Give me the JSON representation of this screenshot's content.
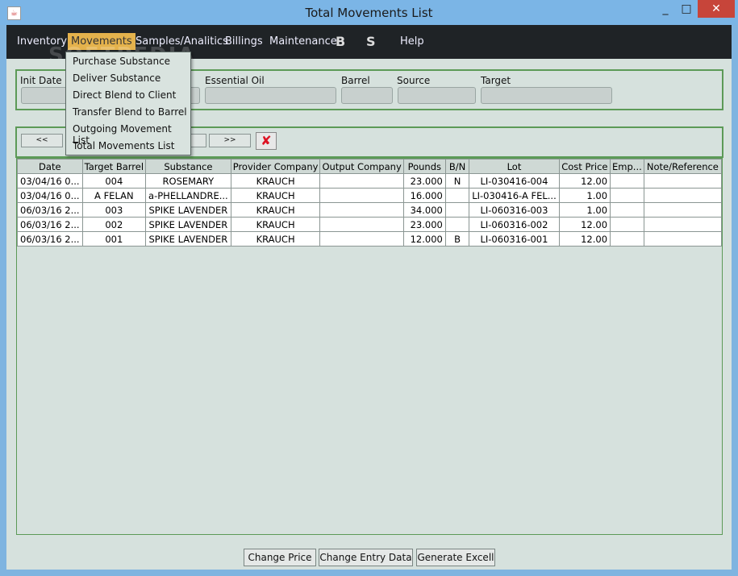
{
  "window": {
    "title": "Total Movements List",
    "minimize": "_",
    "maximize": "□",
    "close": "✕"
  },
  "menubar": {
    "items": [
      "Inventory",
      "Movements",
      "Samples/Analitics",
      "Billings",
      "Maintenance",
      "B",
      "S",
      "Help"
    ]
  },
  "watermark": "SOFTPEDIA",
  "dropdown": {
    "items": [
      "Purchase Substance",
      "Deliver Substance",
      "Direct Blend to Client",
      "Transfer Blend to Barrel",
      "Outgoing Movement List",
      "Total Movements List"
    ]
  },
  "filters": {
    "init_date": "Init Date",
    "essential_oil": "Essential Oil",
    "barrel": "Barrel",
    "source": "Source",
    "target": "Target"
  },
  "nav": {
    "prev": "<<",
    "next": ">>"
  },
  "table": {
    "headers": [
      "Date",
      "Target Barrel",
      "Substance",
      "Provider Company",
      "Output Company",
      "Pounds",
      "B/N",
      "Lot",
      "Cost Price",
      "Emp...",
      "Note/Reference"
    ],
    "rows": [
      [
        "03/04/16 0...",
        "004",
        "ROSEMARY",
        "KRAUCH",
        "",
        "23.000",
        "N",
        "LI-030416-004",
        "12.00",
        "",
        ""
      ],
      [
        "03/04/16 0...",
        "A FELAN",
        "a-PHELLANDRE...",
        "KRAUCH",
        "",
        "16.000",
        "",
        "LI-030416-A FEL...",
        "1.00",
        "",
        ""
      ],
      [
        "06/03/16 2...",
        "003",
        "SPIKE LAVENDER",
        "KRAUCH",
        "",
        "34.000",
        "",
        "LI-060316-003",
        "1.00",
        "",
        ""
      ],
      [
        "06/03/16 2...",
        "002",
        "SPIKE LAVENDER",
        "KRAUCH",
        "",
        "23.000",
        "",
        "LI-060316-002",
        "12.00",
        "",
        ""
      ],
      [
        "06/03/16 2...",
        "001",
        "SPIKE LAVENDER",
        "KRAUCH",
        "",
        "12.000",
        "B",
        "LI-060316-001",
        "12.00",
        "",
        ""
      ]
    ]
  },
  "buttons": {
    "change_price": "Change Price",
    "change_entry": "Change Entry Data",
    "generate": "Generate Excell"
  },
  "colors": {
    "accent_green": "#5c9a57",
    "menu_active": "#e4b24c",
    "menubar_bg": "#1f2326"
  }
}
